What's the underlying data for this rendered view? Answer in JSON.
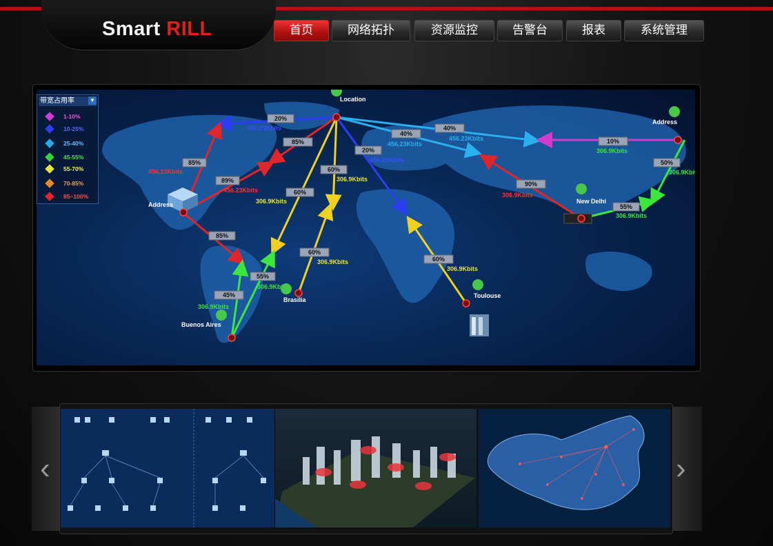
{
  "brand": {
    "part1": "Smart",
    "part2": "RILL"
  },
  "nav": [
    {
      "label": "首页",
      "active": true
    },
    {
      "label": "网络拓扑",
      "active": false
    },
    {
      "label": "资源监控",
      "active": false
    },
    {
      "label": "告警台",
      "active": false
    },
    {
      "label": "报表",
      "active": false
    },
    {
      "label": "系统管理",
      "active": false
    }
  ],
  "legend": {
    "title": "带宽占用率",
    "items": [
      {
        "label": "1-10%",
        "color": "#d23bd0"
      },
      {
        "label": "10-25%",
        "color": "#2f3cf0"
      },
      {
        "label": "25-40%",
        "color": "#2aa8ea"
      },
      {
        "label": "45-55%",
        "color": "#38d23a"
      },
      {
        "label": "55-70%",
        "color": "#e7e43a"
      },
      {
        "label": "70-85%",
        "color": "#e58a2c"
      },
      {
        "label": "85~100%",
        "color": "#e0262a"
      }
    ]
  },
  "map": {
    "nodes": {
      "location": "Location",
      "address_east": "Address",
      "address_west": "Address",
      "new_delhi": "New Delhi",
      "brasilia": "Brasilia",
      "toulouse": "Toulouse",
      "buenos_aires": "Buenos Aires"
    },
    "links": [
      {
        "pct": "20%",
        "rate": "456.23Kbits",
        "color": "#2a3df5"
      },
      {
        "pct": "85%",
        "rate": "",
        "color": "#e0262a"
      },
      {
        "pct": "85%",
        "rate": "456.23Kbits",
        "color": "#e0262a"
      },
      {
        "pct": "89%",
        "rate": "456.23Kbits",
        "color": "#e0262a"
      },
      {
        "pct": "85%",
        "rate": "",
        "color": "#e0262a"
      },
      {
        "pct": "60%",
        "rate": "306.9Kbits",
        "color": "#f0d020"
      },
      {
        "pct": "60%",
        "rate": "306.9Kbits",
        "color": "#f0d020"
      },
      {
        "pct": "60%",
        "rate": "306.9Kbits",
        "color": "#f0d020"
      },
      {
        "pct": "60%",
        "rate": "306.9Kbits",
        "color": "#f0d020"
      },
      {
        "pct": "20%",
        "rate": "456.23Kbits",
        "color": "#2a3df5"
      },
      {
        "pct": "40%",
        "rate": "456.23Kbits",
        "color": "#2ab0ee"
      },
      {
        "pct": "40%",
        "rate": "456.23Kbits",
        "color": "#2ab0ee"
      },
      {
        "pct": "10%",
        "rate": "306.9Kbits",
        "color": "#d23bd0"
      },
      {
        "pct": "50%",
        "rate": "306.9Kbits",
        "color": "#3ce63c"
      },
      {
        "pct": "90%",
        "rate": "306.9Kbits",
        "color": "#e0262a"
      },
      {
        "pct": "55%",
        "rate": "306.9Kbits",
        "color": "#3ce63c"
      },
      {
        "pct": "55%",
        "rate": "306.9Kbits",
        "color": "#3ce63c"
      },
      {
        "pct": "45%",
        "rate": "306.9Kbits",
        "color": "#3ce63c"
      }
    ]
  },
  "carousel": {
    "prev": "‹",
    "next": "›"
  }
}
